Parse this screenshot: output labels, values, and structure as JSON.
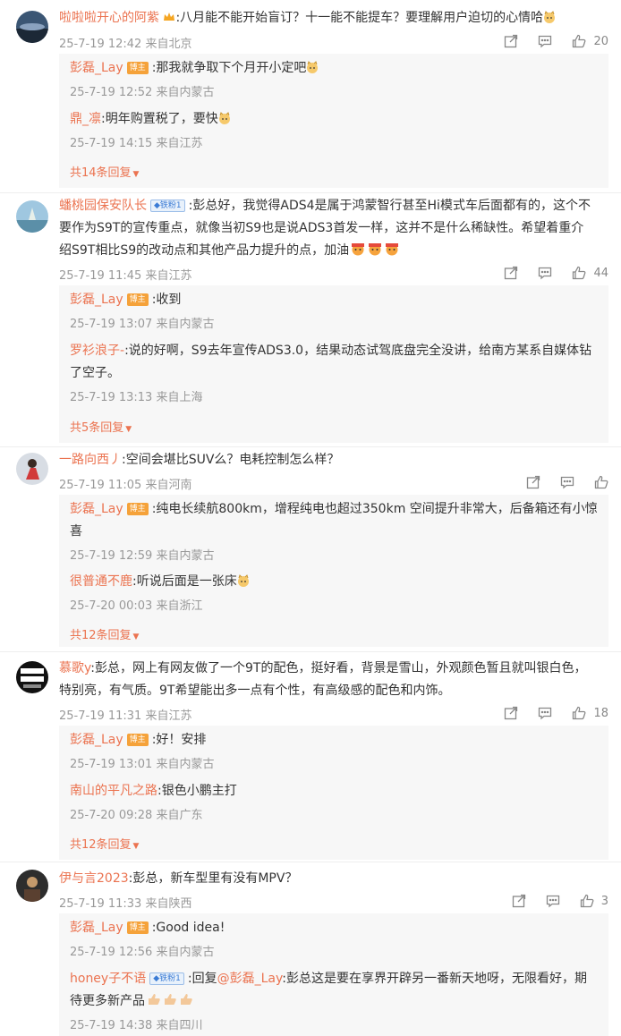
{
  "comments": [
    {
      "user": "啦啦啦开心的阿紫",
      "text": ":八月能不能开始盲订？十一能不能提车？要理解用户迫切的心情哈",
      "time": "25-7-19 12:42 来自北京",
      "likes": "20",
      "replies": [
        {
          "user": "彭磊_Lay",
          "badge": "博主",
          "text": ":那我就争取下个月开小定吧",
          "time": "25-7-19 12:52 来自内蒙古"
        },
        {
          "user": "鼎_凛",
          "text": ":明年购置税了，要快",
          "time": "25-7-19 14:15 来自江苏"
        }
      ],
      "more": "共14条回复"
    },
    {
      "user": "蟠桃园保安队长",
      "fan_badge": "铁粉1",
      "text_line1": ":彭总好，我觉得ADS4是属于鸿蒙智行甚至Hi模式车后面都有的，这个不",
      "text_line2": "要作为S9T的宣传重点，就像当初S9也是说ADS3首发一样，这并不是什么稀缺性。希望着重介",
      "text_line3": "绍S9T相比S9的改动点和其他产品力提升的点，加油",
      "time": "25-7-19 11:45 来自江苏",
      "likes": "44",
      "replies": [
        {
          "user": "彭磊_Lay",
          "badge": "博主",
          "text": ":收到",
          "time": "25-7-19 13:07 来自内蒙古"
        },
        {
          "user": "罗衫浪子-",
          "text_line1": ":说的好啊，S9去年宣传ADS3.0，结果动态试驾底盘完全没讲，给南方某系自媒体钻",
          "text_line2": "了空子。",
          "time": "25-7-19 13:13 来自上海"
        }
      ],
      "more": "共5条回复"
    },
    {
      "user": "一路向西丿",
      "text": ":空间会堪比SUV么？电耗控制怎么样？",
      "time": "25-7-19 11:05 来自河南",
      "replies": [
        {
          "user": "彭磊_Lay",
          "badge": "博主",
          "text_line1": ":纯电长续航800km，增程纯电也超过350km 空间提升非常大，后备箱还有小惊",
          "text_line2": "喜",
          "time": "25-7-19 12:59 来自内蒙古"
        },
        {
          "user": "很普通不鹿",
          "text": ":听说后面是一张床",
          "time": "25-7-20 00:03 来自浙江"
        }
      ],
      "more": "共12条回复"
    },
    {
      "user": "慕歌y",
      "text_line1": ":彭总，网上有网友做了一个9T的配色，挺好看，背景是雪山，外观颜色暂且就叫银白色，",
      "text_line2": "特别亮，有气质。9T希望能出多一点有个性，有高级感的配色和内饰。",
      "time": "25-7-19 11:31 来自江苏",
      "likes": "18",
      "replies": [
        {
          "user": "彭磊_Lay",
          "badge": "博主",
          "text": ":好！安排",
          "time": "25-7-19 13:01 来自内蒙古"
        },
        {
          "user": "南山的平凡之路",
          "text": ":银色小鹏主打",
          "time": "25-7-20 09:28 来自广东"
        }
      ],
      "more": "共12条回复"
    },
    {
      "user": "伊与言2023",
      "text": ":彭总，新车型里有没有MPV？",
      "time": "25-7-19 11:33 来自陕西",
      "likes": "3",
      "replies": [
        {
          "user": "彭磊_Lay",
          "badge": "博主",
          "text": ":Good idea!",
          "time": "25-7-19 12:56 来自内蒙古"
        },
        {
          "user": "honey子不语",
          "fan_badge": "铁粉1",
          "text_prefix": ":回复",
          "mention": "@彭磊_Lay",
          "text_line1": ":彭总这是要在享界开辟另一番新天地呀，无限看好，期",
          "text_line2": "待更多新产品",
          "time": "25-7-19 14:38 来自四川"
        }
      ]
    }
  ],
  "icons": {
    "share": "share-icon",
    "comment": "comment-icon",
    "like": "thumbs-up-icon",
    "more": "chevron-down-icon"
  },
  "colors": {
    "username": "#eb7350",
    "reply_bg": "#f7f7f7",
    "meta": "#999999"
  }
}
